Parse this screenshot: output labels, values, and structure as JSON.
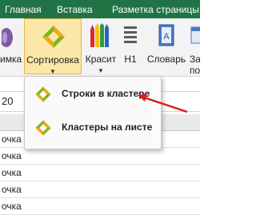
{
  "tabs": [
    "Главная",
    "Вставка",
    "Разметка страницы"
  ],
  "ribbon": {
    "buttons": [
      {
        "label": "имка",
        "icon": "paint-icon"
      },
      {
        "label": "Сортировка",
        "icon": "sort-diamond-icon"
      },
      {
        "label": "Красит",
        "icon": "pencils-icon"
      },
      {
        "label": "H1",
        "icon": "heading-icon"
      },
      {
        "label": "Словарь",
        "icon": "dictionary-icon"
      },
      {
        "label": "За",
        "icon": "window-icon"
      }
    ],
    "sublabel_tail": "по"
  },
  "formula_bar": {
    "value": "20"
  },
  "menu": {
    "items": [
      {
        "label": "Строки в кластере",
        "icon": "sort-diamond-icon"
      },
      {
        "label": "Кластеры на листе",
        "icon": "sort-diamond-icon"
      }
    ]
  },
  "grid": {
    "rows": [
      "очка",
      "очка",
      "очка",
      "очка",
      "очка"
    ]
  },
  "colors": {
    "tab_bar": "#217346",
    "active_button": "#fde7a8",
    "annotation_arrow": "#e01b1b"
  }
}
